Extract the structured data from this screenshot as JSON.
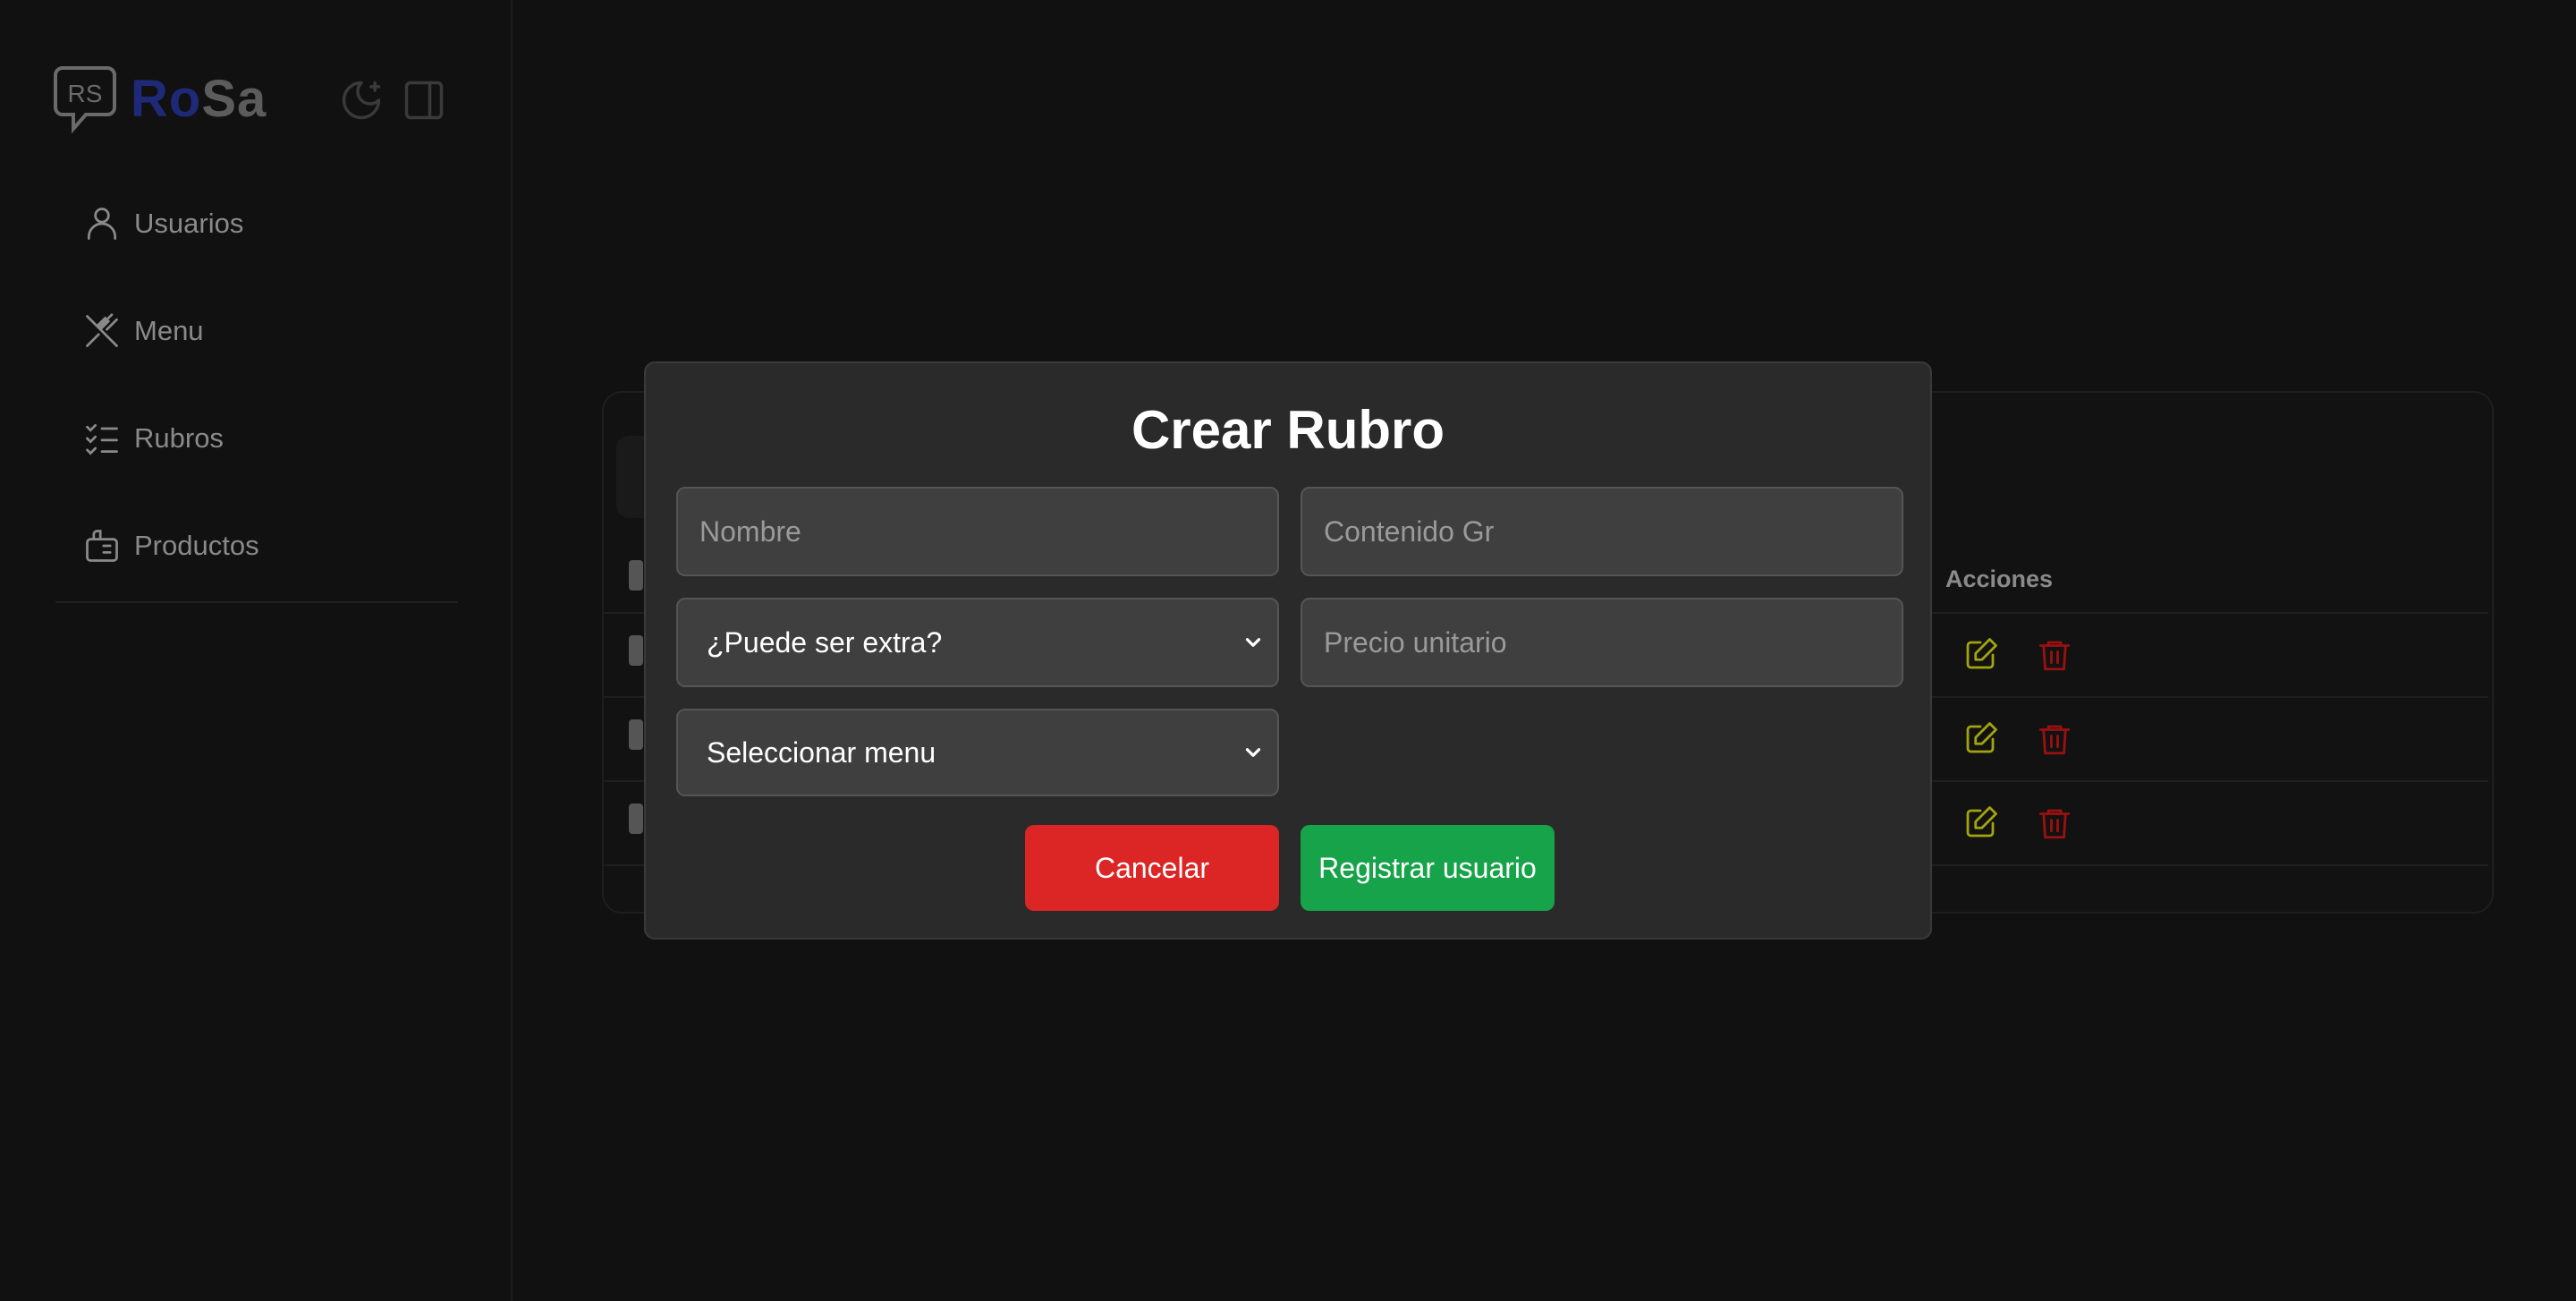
{
  "brand": {
    "name_part1": "Ro",
    "name_part2": "Sa",
    "logo_text": "RS"
  },
  "sidebar": {
    "items": [
      {
        "label": "Usuarios",
        "icon": "user-icon"
      },
      {
        "label": "Menu",
        "icon": "utensils-crossed-icon"
      },
      {
        "label": "Rubros",
        "icon": "list-checks-icon"
      },
      {
        "label": "Productos",
        "icon": "package-icon"
      }
    ]
  },
  "table": {
    "header_actions": "Acciones",
    "rows": 3
  },
  "modal": {
    "title": "Crear Rubro",
    "nombre_placeholder": "Nombre",
    "contenido_placeholder": "Contenido Gr",
    "extra_select": "¿Puede ser extra?",
    "precio_placeholder": "Precio unitario",
    "menu_select": "Seleccionar menu",
    "cancel_label": "Cancelar",
    "submit_label": "Registrar usuario"
  },
  "colors": {
    "cancel": "#dc2626",
    "submit": "#16a34a",
    "edit_icon": "#a3a30f",
    "delete_icon": "#9b1010"
  }
}
